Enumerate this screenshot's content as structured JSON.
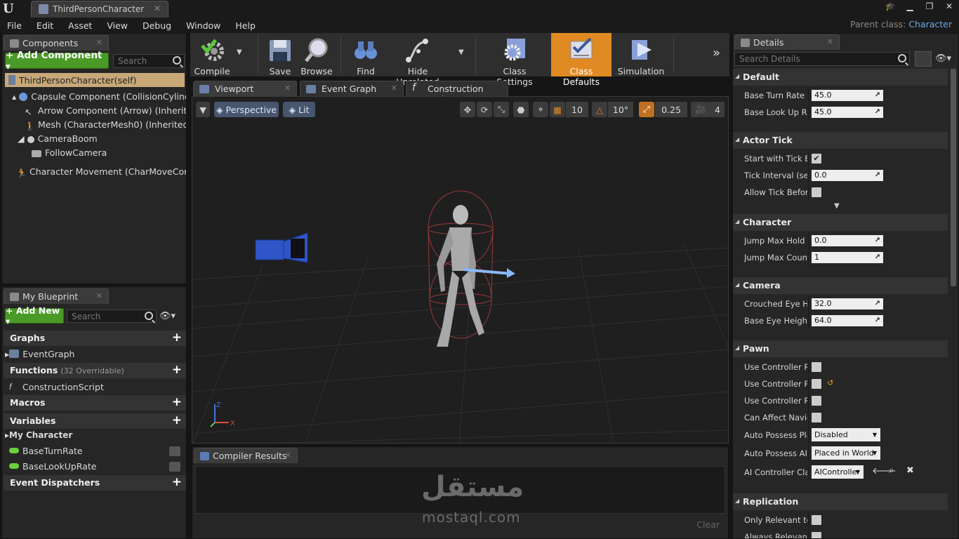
{
  "window": {
    "tab_title": "ThirdPersonCharacter",
    "parent_class_label": "Parent class:",
    "parent_class_value": "Character"
  },
  "menu": [
    "File",
    "Edit",
    "Asset",
    "View",
    "Debug",
    "Window",
    "Help"
  ],
  "components": {
    "tab": "Components",
    "add_button": "+ Add Component ▾",
    "search_placeholder": "Search",
    "root": "ThirdPersonCharacter(self)",
    "items": [
      "Capsule Component (CollisionCylinder) (",
      "Arrow Component (Arrow) (Inherited)",
      "Mesh (CharacterMesh0) (Inherited)",
      "CameraBoom",
      "FollowCamera",
      "Character Movement (CharMoveComp) (I"
    ]
  },
  "my_blueprint": {
    "tab": "My Blueprint",
    "add_new": "+ Add New ▾",
    "search_placeholder": "Search",
    "graphs_label": "Graphs",
    "event_graph": "EventGraph",
    "functions_label": "Functions",
    "functions_note": "(32 Overridable)",
    "construction_script": "ConstructionScript",
    "macros_label": "Macros",
    "variables_label": "Variables",
    "my_character": "My Character",
    "var1": "BaseTurnRate",
    "var2": "BaseLookUpRate",
    "dispatchers_label": "Event Dispatchers"
  },
  "toolbar": {
    "compile": "Compile",
    "save": "Save",
    "browse": "Browse",
    "find": "Find",
    "hide_unrelated": "Hide Unrelated",
    "class_settings": "Class Settings",
    "class_defaults": "Class Defaults",
    "simulation": "Simulation"
  },
  "editor_tabs": {
    "viewport": "Viewport",
    "event_graph": "Event Graph",
    "construction": "Construction Scrip"
  },
  "viewport": {
    "perspective": "Perspective",
    "lit": "Lit",
    "grid_snap": "10",
    "rot_snap": "10°",
    "scale_snap": "0.25",
    "cam_speed": "4",
    "axis_x": "X",
    "axis_z": "Z"
  },
  "compiler": {
    "tab": "Compiler Results",
    "clear": "Clear",
    "watermark_ar": "مستقل",
    "watermark_en": "mostaql.com"
  },
  "details": {
    "tab": "Details",
    "search_placeholder": "Search Details",
    "sections": {
      "default": "Default",
      "actor_tick": "Actor Tick",
      "character": "Character",
      "camera": "Camera",
      "pawn": "Pawn",
      "replication": "Replication"
    },
    "rows": {
      "base_turn_rate": {
        "label": "Base Turn Rate",
        "value": "45.0"
      },
      "base_look_up": {
        "label": "Base Look Up Rate",
        "value": "45.0"
      },
      "start_tick": {
        "label": "Start with Tick Enabled"
      },
      "tick_interval": {
        "label": "Tick Interval (secs)",
        "value": "0.0"
      },
      "allow_tick": {
        "label": "Allow Tick Before Begin Play"
      },
      "jump_hold": {
        "label": "Jump Max Hold Time",
        "value": "0.0"
      },
      "jump_count": {
        "label": "Jump Max Count",
        "value": "1"
      },
      "crouched_eye": {
        "label": "Crouched Eye Height",
        "value": "32.0"
      },
      "base_eye": {
        "label": "Base Eye Height",
        "value": "64.0"
      },
      "use_ctrl_pitch": {
        "label": "Use Controller Rotation Pitch"
      },
      "use_ctrl_yaw": {
        "label": "Use Controller Rotation Yaw"
      },
      "use_ctrl_roll": {
        "label": "Use Controller Rotation Roll"
      },
      "can_affect_nav": {
        "label": "Can Affect Navigation"
      },
      "auto_possess_player": {
        "label": "Auto Possess Player",
        "value": "Disabled"
      },
      "auto_possess_ai": {
        "label": "Auto Possess AI",
        "value": "Placed in World"
      },
      "ai_controller": {
        "label": "AI Controller Class",
        "value": "AIController"
      },
      "only_relevant": {
        "label": "Only Relevant to Owner"
      },
      "always_relevant": {
        "label": "Always Relevant"
      }
    }
  }
}
